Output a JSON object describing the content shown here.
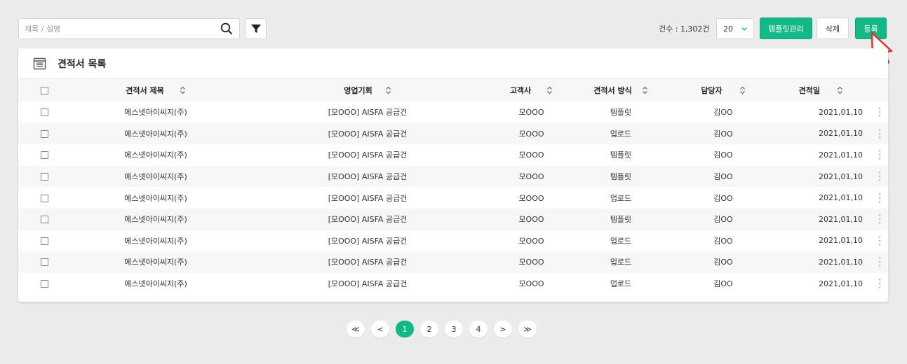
{
  "search": {
    "placeholder": "제목 / 설명",
    "value": ""
  },
  "toolbar": {
    "count_label": "건수 : 1,302건",
    "per_page": "20",
    "template_label": "템플릿관리",
    "delete_label": "삭제",
    "register_label": "등록"
  },
  "colors": {
    "accent": "#12b886",
    "background": "#ececec"
  },
  "panel": {
    "title": "견적서 목록"
  },
  "table": {
    "headers": [
      "견적서 제목",
      "영업기회",
      "고객사",
      "견적서 방식",
      "담당자",
      "견적일"
    ],
    "rows": [
      {
        "title": "에스넷아이씨지(주)",
        "opportunity": "[모OOO] AISFA 공급건",
        "customer": "모OOO",
        "method": "템플릿",
        "manager": "김OO",
        "date": "2021,01,10"
      },
      {
        "title": "에스넷아이씨지(주)",
        "opportunity": "[모OOO] AISFA 공급건",
        "customer": "모OOO",
        "method": "업로드",
        "manager": "김OO",
        "date": "2021,01,10"
      },
      {
        "title": "에스넷아이씨지(주)",
        "opportunity": "[모OOO] AISFA 공급건",
        "customer": "모OOO",
        "method": "템플릿",
        "manager": "김OO",
        "date": "2021,01,10"
      },
      {
        "title": "에스넷아이씨지(주)",
        "opportunity": "[모OOO] AISFA 공급건",
        "customer": "모OOO",
        "method": "템플릿",
        "manager": "김OO",
        "date": "2021,01,10"
      },
      {
        "title": "에스넷아이씨지(주)",
        "opportunity": "[모OOO] AISFA 공급건",
        "customer": "모OOO",
        "method": "업로드",
        "manager": "김OO",
        "date": "2021,01,10"
      },
      {
        "title": "에스넷아이씨지(주)",
        "opportunity": "[모OOO] AISFA 공급건",
        "customer": "모OOO",
        "method": "템플릿",
        "manager": "김OO",
        "date": "2021,01,10"
      },
      {
        "title": "에스넷아이씨지(주)",
        "opportunity": "[모OOO] AISFA 공급건",
        "customer": "모OOO",
        "method": "업로드",
        "manager": "김OO",
        "date": "2021,01,10"
      },
      {
        "title": "에스넷아이씨지(주)",
        "opportunity": "[모OOO] AISFA 공급건",
        "customer": "모OOO",
        "method": "업로드",
        "manager": "김OO",
        "date": "2021,01,10"
      },
      {
        "title": "에스넷아이씨지(주)",
        "opportunity": "[모OOO] AISFA 공급건",
        "customer": "모OOO",
        "method": "업로드",
        "manager": "김OO",
        "date": "2021,01,10"
      }
    ]
  },
  "pagination": {
    "first": "≪",
    "prev": "<",
    "next": ">",
    "last": "≫",
    "pages": [
      "1",
      "2",
      "3",
      "4"
    ],
    "current": "1"
  }
}
